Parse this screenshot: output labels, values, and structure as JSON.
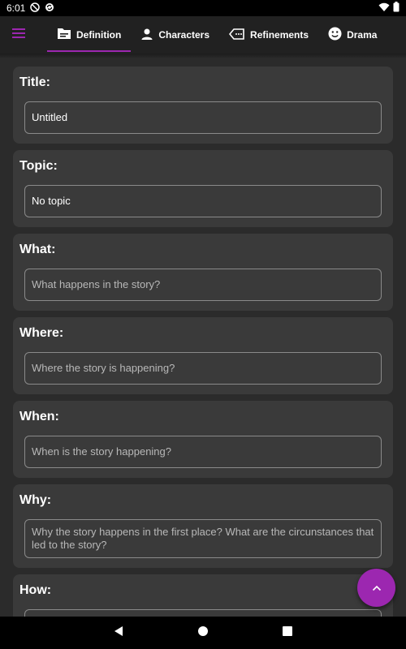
{
  "status": {
    "time": "6:01"
  },
  "tabs": [
    {
      "label": "Definition",
      "icon": "document-icon"
    },
    {
      "label": "Characters",
      "icon": "person-icon"
    },
    {
      "label": "Refinements",
      "icon": "label-icon"
    },
    {
      "label": "Drama",
      "icon": "face-icon"
    }
  ],
  "colors": {
    "accent": "#9c27b0",
    "card": "#3a3a3a",
    "background": "#2b2b2b"
  },
  "form": {
    "title": {
      "label": "Title:",
      "value": "Untitled"
    },
    "topic": {
      "label": "Topic:",
      "value": "No topic"
    },
    "what": {
      "label": "What:",
      "placeholder": "What happens in the story?"
    },
    "where": {
      "label": "Where:",
      "placeholder": "Where the story is happening?"
    },
    "when": {
      "label": "When:",
      "placeholder": "When is the story happening?"
    },
    "why": {
      "label": "Why:",
      "placeholder": "Why the story happens in the first place? What are the circunstances that led to the story?"
    },
    "how": {
      "label": "How:"
    }
  }
}
